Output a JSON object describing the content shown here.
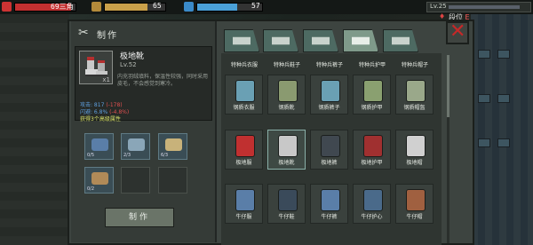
{
  "hud": {
    "health_value": "69三角",
    "health_fill": 0.92,
    "hunger_value": "65",
    "hunger_fill": 0.71,
    "water_value": "57",
    "water_fill": 0.62,
    "level_label": "Lv.25",
    "rank_label": "段位",
    "rank_letter": "E"
  },
  "craft_panel": {
    "title": "制作",
    "item": {
      "name": "极地靴",
      "level": "Lv.52",
      "count": "x1",
      "description": "内充羽绒填料，保温性较强，同时采用皮毛，不会感觉到寒冷。",
      "stat_attack_label": "攻击: 817",
      "stat_attack_delta": "(-178)",
      "stat_dodge_label": "闪避: 6.8%",
      "stat_dodge_delta": "(-4.8%)",
      "extra_attrs": "获得3个高级属性"
    },
    "materials": [
      {
        "name": "material-cloth",
        "count": "0/5",
        "color": "#5a7ea8"
      },
      {
        "name": "material-wire",
        "count": "2/3",
        "color": "#8aa6b8"
      },
      {
        "name": "material-leather",
        "count": "6/3",
        "color": "#c8b27a"
      },
      {
        "name": "material-rope",
        "count": "0/2",
        "color": "#b08a58"
      }
    ],
    "craft_button": "制作"
  },
  "tabs": [
    {
      "name": "tab-backpack",
      "icon": "backpack-icon",
      "active": false
    },
    {
      "name": "tab-medkit",
      "icon": "medkit-icon",
      "active": false
    },
    {
      "name": "tab-melee",
      "icon": "melee-icon",
      "active": false
    },
    {
      "name": "tab-gun",
      "icon": "gun-icon",
      "active": true
    },
    {
      "name": "tab-rifle",
      "icon": "rifle-icon",
      "active": false
    }
  ],
  "grid": {
    "columns": [
      "特种兵衣服",
      "特种兵鞋子",
      "特种兵裤子",
      "特种兵护甲",
      "特种兵帽子"
    ],
    "rows": [
      [
        {
          "label": "钢质衣服",
          "icon": "vest-icon",
          "color": "#6aa0b4"
        },
        {
          "label": "钢质靴",
          "icon": "boots-icon",
          "color": "#8a9a70"
        },
        {
          "label": "钢质裤子",
          "icon": "pants-icon",
          "color": "#6aa0b4"
        },
        {
          "label": "钢质护甲",
          "icon": "armor-icon",
          "color": "#8aa070"
        },
        {
          "label": "钢质帽盔",
          "icon": "helmet-icon",
          "color": "#9aa88a"
        }
      ],
      [
        {
          "label": "极地服",
          "icon": "jacket-icon",
          "color": "#c03030"
        },
        {
          "label": "极地靴",
          "icon": "boots-icon",
          "color": "#c8c8c8",
          "selected": true
        },
        {
          "label": "极地裤",
          "icon": "pants-icon",
          "color": "#404850"
        },
        {
          "label": "极地护甲",
          "icon": "armor-icon",
          "color": "#a03030"
        },
        {
          "label": "极地帽",
          "icon": "hat-icon",
          "color": "#d0d0d0"
        }
      ],
      [
        {
          "label": "牛仔服",
          "icon": "jacket-icon",
          "color": "#5a7ea8"
        },
        {
          "label": "牛仔鞋",
          "icon": "shoes-icon",
          "color": "#3a4a5a"
        },
        {
          "label": "牛仔裤",
          "icon": "pants-icon",
          "color": "#5a7ea8"
        },
        {
          "label": "牛仔护心",
          "icon": "vest-icon",
          "color": "#4a6a8a"
        },
        {
          "label": "牛仔帽",
          "icon": "hat-icon",
          "color": "#a06040"
        }
      ]
    ]
  }
}
